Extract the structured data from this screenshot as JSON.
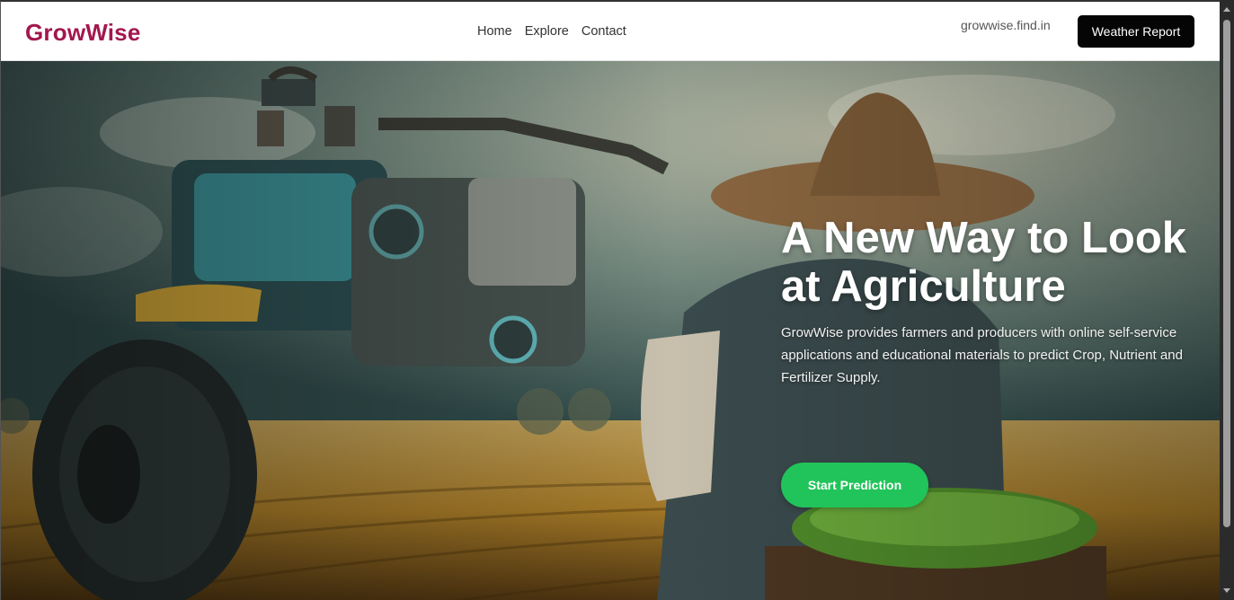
{
  "brand": {
    "name": "GrowWise",
    "color": "#a3164e"
  },
  "nav": {
    "items": [
      {
        "label": "Home"
      },
      {
        "label": "Explore"
      },
      {
        "label": "Contact"
      }
    ]
  },
  "header": {
    "domain": "growwise.find.in",
    "weather_button": "Weather Report"
  },
  "hero": {
    "title": "A New Way to Look at Agriculture",
    "description": "GrowWise provides farmers and producers with online self-service applications and educational materials to predict Crop, Nutrient and Fertilizer Supply.",
    "cta_label": "Start Prediction",
    "cta_color": "#21c45a",
    "background_image": "robotic-tractor-and-farmer-in-wheat-field"
  }
}
